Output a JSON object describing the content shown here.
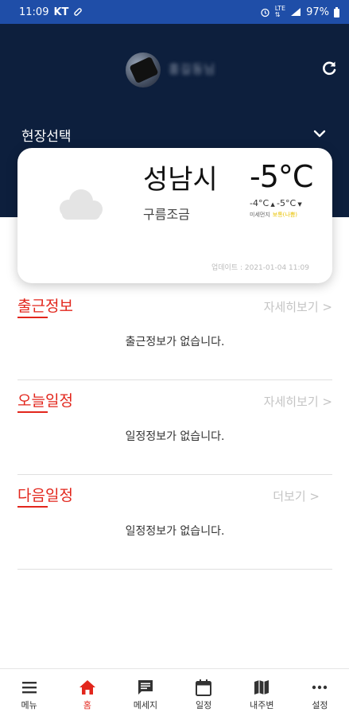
{
  "status_bar": {
    "time": "11:09",
    "carrier": "KT",
    "battery": "97%"
  },
  "header": {
    "username": "홍길동님",
    "site_select_label": "현장선택"
  },
  "weather": {
    "city": "성남시",
    "condition": "구름조금",
    "temperature": "-5°C",
    "temp_min": "-4°C",
    "temp_max": "-5°C",
    "dust_label": "미세먼지",
    "dust_grade": "보통(나쁨)",
    "updated": "업데이트 : 2021-01-04 11:09"
  },
  "sections": [
    {
      "title": "출근정보",
      "more": "자세히보기 >",
      "empty": "출근정보가 없습니다."
    },
    {
      "title": "오늘일정",
      "more": "자세히보기 >",
      "empty": "일정정보가 없습니다."
    },
    {
      "title": "다음일정",
      "more": "더보기 >",
      "empty": "일정정보가 없습니다."
    }
  ],
  "nav": [
    {
      "label": "메뉴",
      "icon": "menu-icon",
      "active": false
    },
    {
      "label": "홈",
      "icon": "home-icon",
      "active": true
    },
    {
      "label": "메세지",
      "icon": "message-icon",
      "active": false
    },
    {
      "label": "일정",
      "icon": "calendar-icon",
      "active": false
    },
    {
      "label": "내주변",
      "icon": "map-icon",
      "active": false
    },
    {
      "label": "설정",
      "icon": "more-icon",
      "active": false
    }
  ],
  "colors": {
    "accent": "#e2261c",
    "header_bg": "#0d1f3d",
    "status_bar_bg": "#1f4ea8"
  }
}
